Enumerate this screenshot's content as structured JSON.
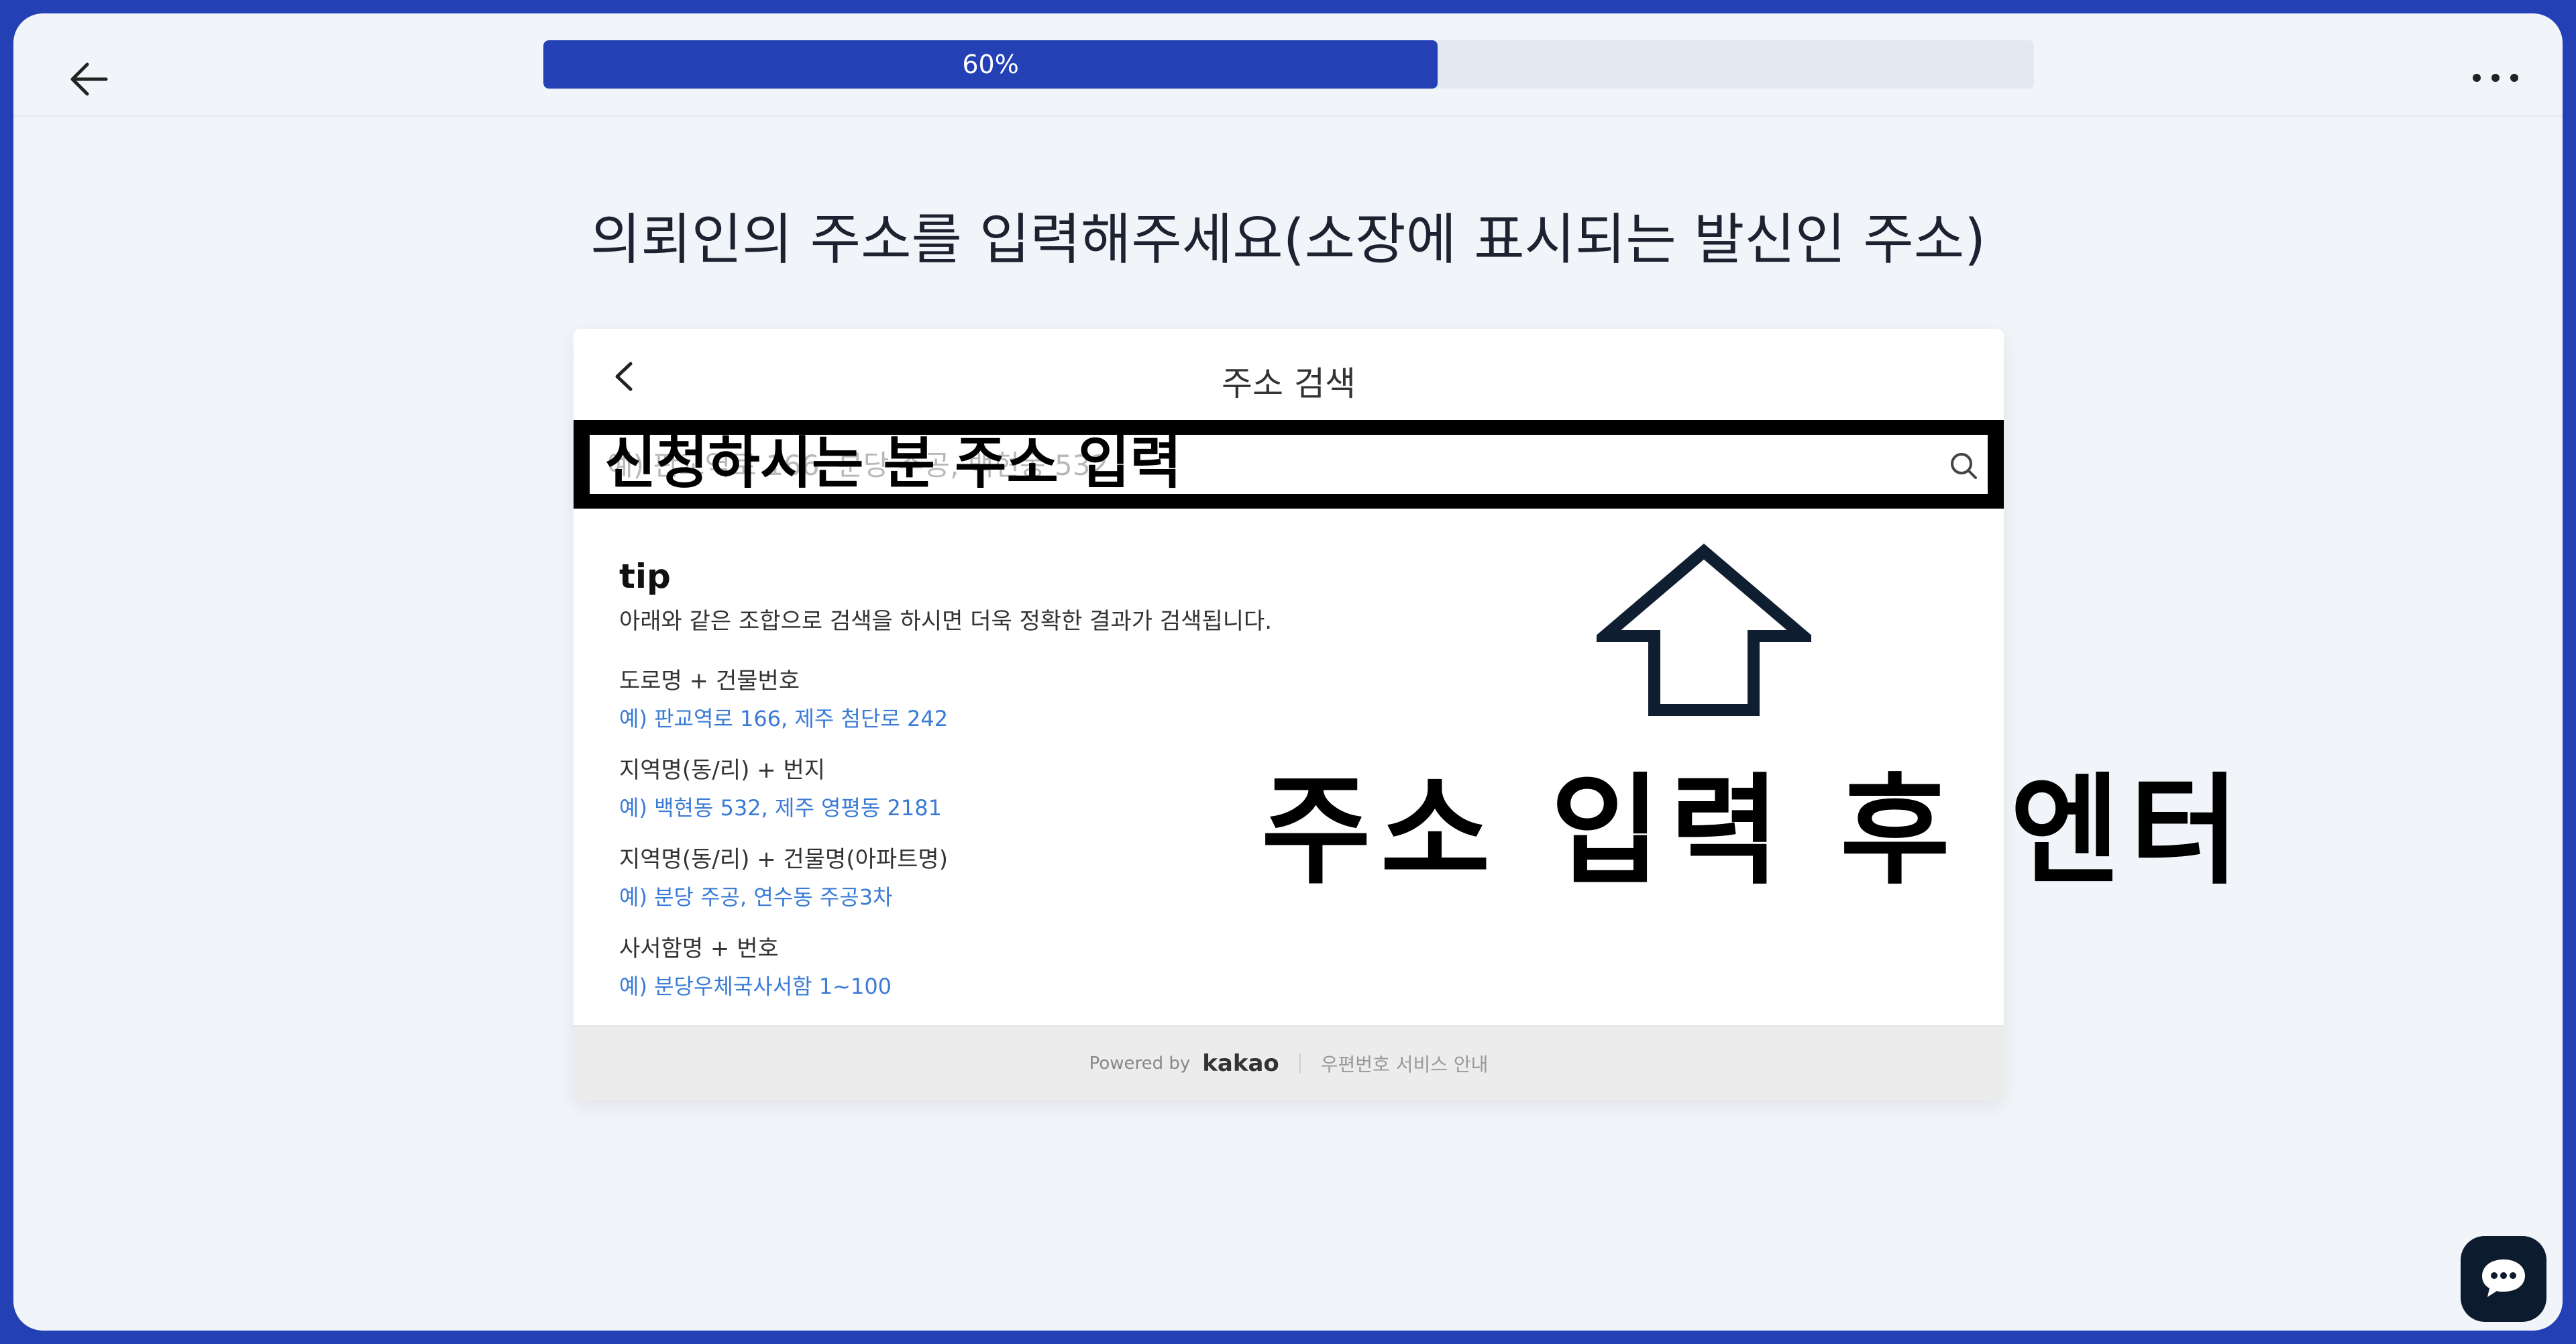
{
  "progress": {
    "percent": 60,
    "label": "60%"
  },
  "headline": "의뢰인의 주소를 입력해주세요(소장에 표시되는 발신인 주소)",
  "dialog": {
    "title": "주소 검색",
    "search": {
      "placeholder": "예) 판교역로 166, 분당 주공, 백현동 532",
      "overlay_text": "신청하시는 분 주소 입력"
    },
    "tip": {
      "title": "tip",
      "description": "아래와 같은 조합으로 검색을 하시면 더욱 정확한 결과가 검색됩니다.",
      "items": [
        {
          "label": "도로명 + 건물번호",
          "example": "예) 판교역로 166,  제주 첨단로 242"
        },
        {
          "label": "지역명(동/리) + 번지",
          "example": "예) 백현동 532,  제주 영평동 2181"
        },
        {
          "label": "지역명(동/리) + 건물명(아파트명)",
          "example": "예) 분당 주공,  연수동 주공3차"
        },
        {
          "label": "사서함명 + 번호",
          "example": "예) 분당우체국사서함 1~100"
        }
      ]
    },
    "footer": {
      "powered_by": "Powered by",
      "brand": "kakao",
      "link": "우편번호 서비스 안내"
    }
  },
  "annotation": "주소 입력 후 엔터",
  "icons": {
    "back": "arrow-left-icon",
    "more": "ellipsis-icon",
    "dialog_back": "chevron-left-icon",
    "search": "search-icon",
    "annotation_arrow": "arrow-up-outline-icon",
    "chat": "chat-bubble-icon"
  },
  "colors": {
    "brand": "#2340b4",
    "link": "#3a7bd5",
    "chat_button": "#0d1b2e"
  }
}
